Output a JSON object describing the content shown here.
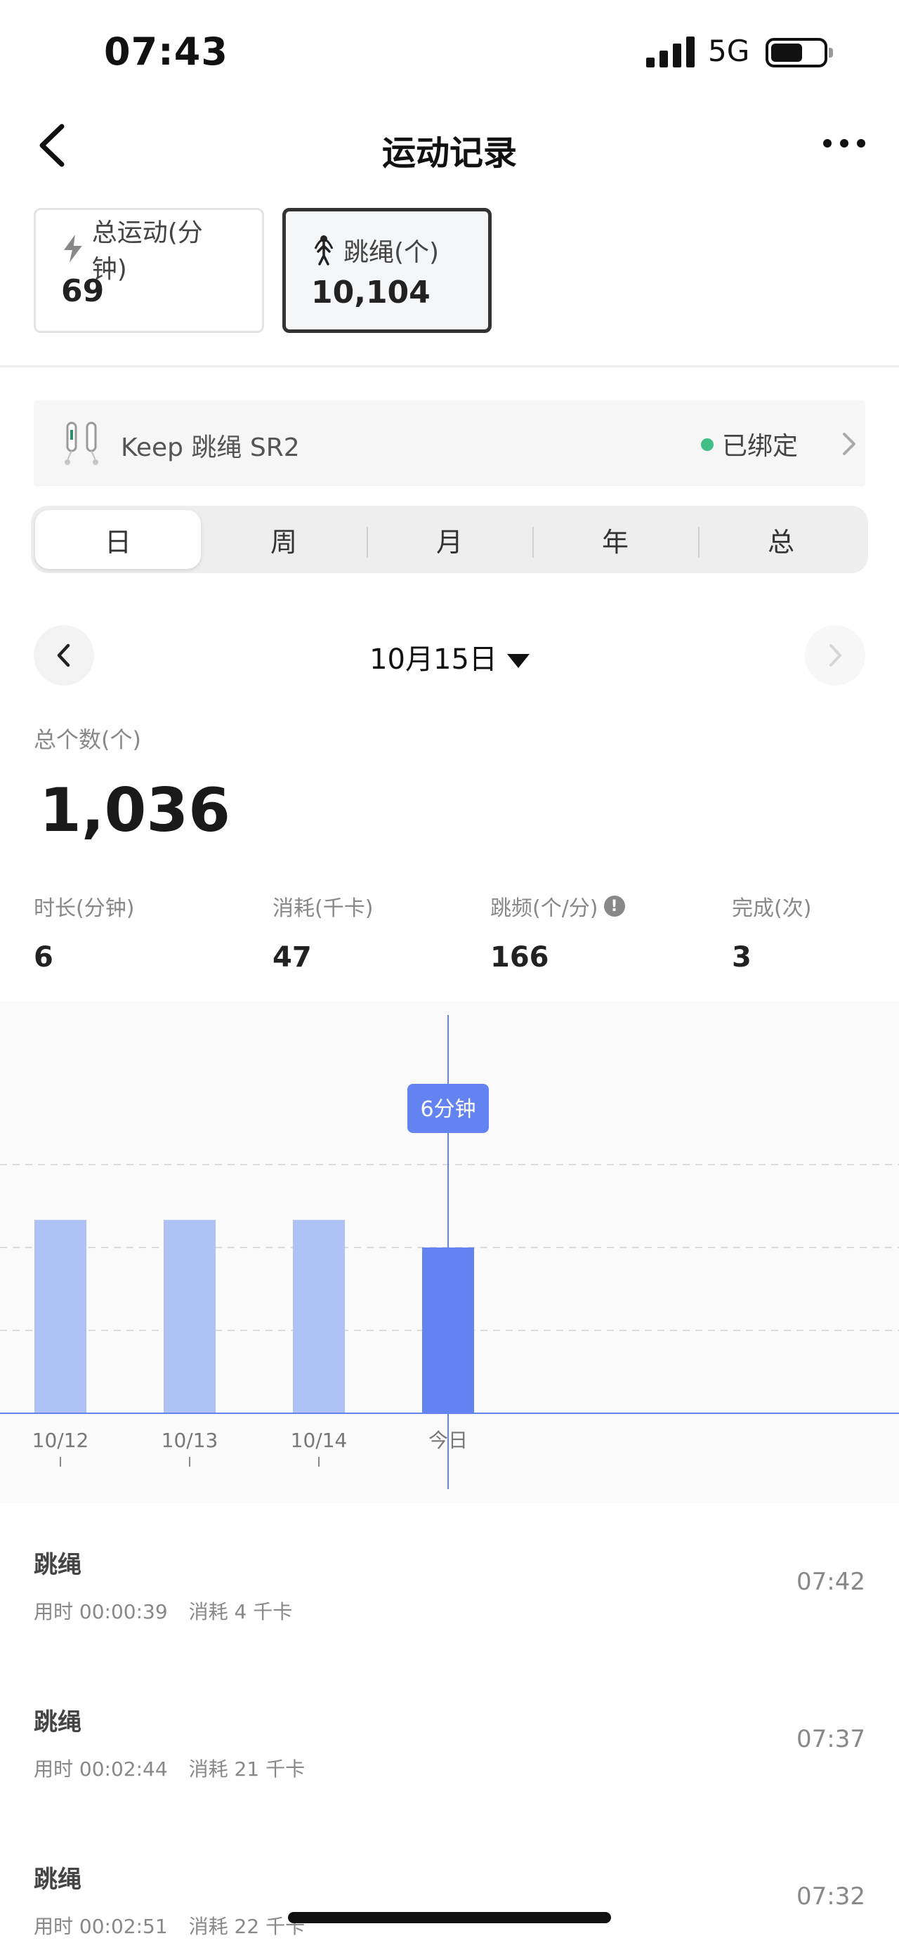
{
  "status_bar": {
    "time": "07:43",
    "network": "5G"
  },
  "nav": {
    "title": "运动记录"
  },
  "summary": {
    "total": {
      "label": "总运动(分钟)",
      "value": "69"
    },
    "rope": {
      "label": "跳绳(个)",
      "value": "10,104"
    }
  },
  "device": {
    "name": "Keep 跳绳 SR2",
    "status": "已绑定",
    "status_color": "#3fbf85"
  },
  "segments": [
    "日",
    "周",
    "月",
    "年",
    "总"
  ],
  "date": {
    "label": "10月15日"
  },
  "total_count": {
    "label": "总个数(个)",
    "value": "1,036"
  },
  "metrics": [
    {
      "label": "时长(分钟)",
      "value": "6"
    },
    {
      "label": "消耗(千卡)",
      "value": "47"
    },
    {
      "label": "跳频(个/分)",
      "value": "166"
    },
    {
      "label": "完成(次)",
      "value": "3"
    }
  ],
  "chart_data": {
    "type": "bar",
    "categories": [
      "10/12",
      "10/13",
      "10/14",
      "今日"
    ],
    "values": [
      7,
      7,
      7,
      6
    ],
    "selected_index": 3,
    "tooltip": "6分钟",
    "ylim": [
      0,
      12
    ],
    "grid": true,
    "colors": {
      "bar": "#afc2f5",
      "selected": "#6384f0",
      "axis": "#6384f0"
    }
  },
  "records": [
    {
      "title": "跳绳",
      "duration": "用时 00:00:39",
      "calories": "消耗 4 千卡",
      "time": "07:42"
    },
    {
      "title": "跳绳",
      "duration": "用时 00:02:44",
      "calories": "消耗 21 千卡",
      "time": "07:37"
    },
    {
      "title": "跳绳",
      "duration": "用时 00:02:51",
      "calories": "消耗 22 千卡",
      "time": "07:32"
    }
  ]
}
